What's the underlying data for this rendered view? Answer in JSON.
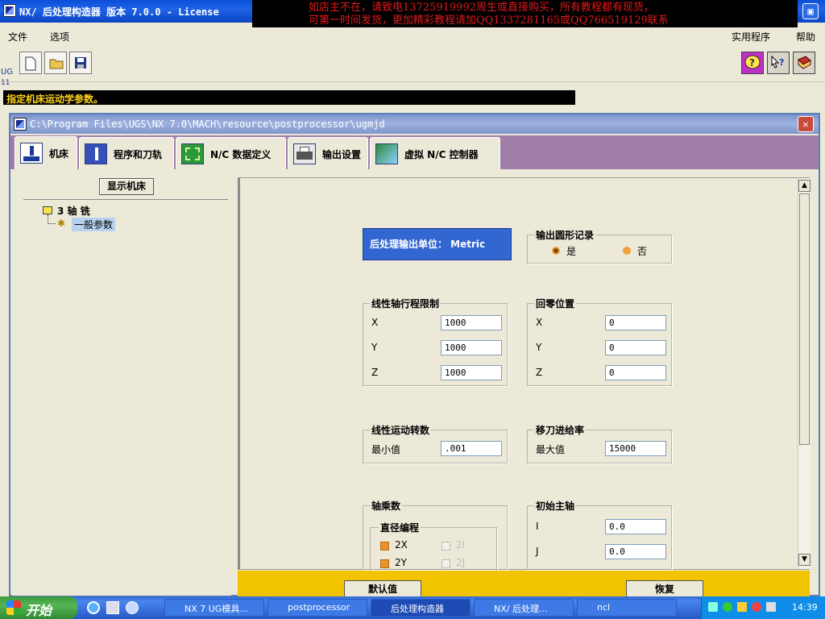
{
  "app": {
    "title": "NX/ 后处理构造器 版本 7.0.0 - License"
  },
  "banner": {
    "line1": "如店主不在，请致电13725919992周生或直接购买，所有教程都有现货，",
    "line2": "可第一时间发货，更加精彩教程请加QQ1337281165或QQ766519129联系"
  },
  "menu": {
    "file": "文件",
    "options": "选项",
    "utility": "实用程序",
    "help": "帮助"
  },
  "sidelabel": {
    "ug": "UG",
    "num": "11"
  },
  "status": {
    "text": "指定机床运动学参数。"
  },
  "window": {
    "path": "C:\\Program Files\\UGS\\NX 7.0\\MACH\\resource\\postprocessor\\ugmjd"
  },
  "tabs": [
    {
      "label": "机床"
    },
    {
      "label": "程序和刀轨"
    },
    {
      "label": "N/C 数据定义"
    },
    {
      "label": "输出设置"
    },
    {
      "label": "虚拟 N/C 控制器"
    }
  ],
  "left": {
    "show_machine": "显示机床",
    "tree_root": "3 轴 铣",
    "tree_child": "一般参数"
  },
  "main": {
    "units": "后处理输出单位：  Metric",
    "circ": {
      "title": "输出圆形记录",
      "yes": "是",
      "no": "否"
    },
    "travel": {
      "title": "线性轴行程限制",
      "x_label": "X",
      "x": "1000",
      "y_label": "Y",
      "y": "1000",
      "z_label": "Z",
      "z": "1000"
    },
    "home": {
      "title": "回零位置",
      "x_label": "X",
      "x": "0",
      "y_label": "Y",
      "y": "0",
      "z_label": "Z",
      "z": "0"
    },
    "motion": {
      "title": "线性运动转数",
      "min_label": "最小值",
      "min": ".001"
    },
    "traverse": {
      "title": "移刀进给率",
      "max_label": "最大值",
      "max": "15000"
    },
    "axis": {
      "title": "轴乘数",
      "diam": "直径编程",
      "c2x": "2X",
      "c2i": "2I",
      "c2y": "2Y",
      "c2j": "2J"
    },
    "spindle": {
      "title": "初始主轴",
      "i_label": "I",
      "i": "0.0",
      "j_label": "J",
      "j": "0.0"
    }
  },
  "buttons": {
    "default": "默认值",
    "restore": "恢复"
  },
  "taskbar": {
    "start": "开始",
    "tasks": [
      {
        "label": "NX 7 UG模具..."
      },
      {
        "label": "postprocessor"
      },
      {
        "label": "后处理构造器"
      },
      {
        "label": "NX/ 后处理..."
      },
      {
        "label": "ncl"
      }
    ],
    "clock": "14:39"
  },
  "colors": {
    "titlebar": "#0a4fd6",
    "status_fg": "#ffd21a",
    "bottom_bar": "#f2c400",
    "units_bg": "#3266d0"
  }
}
